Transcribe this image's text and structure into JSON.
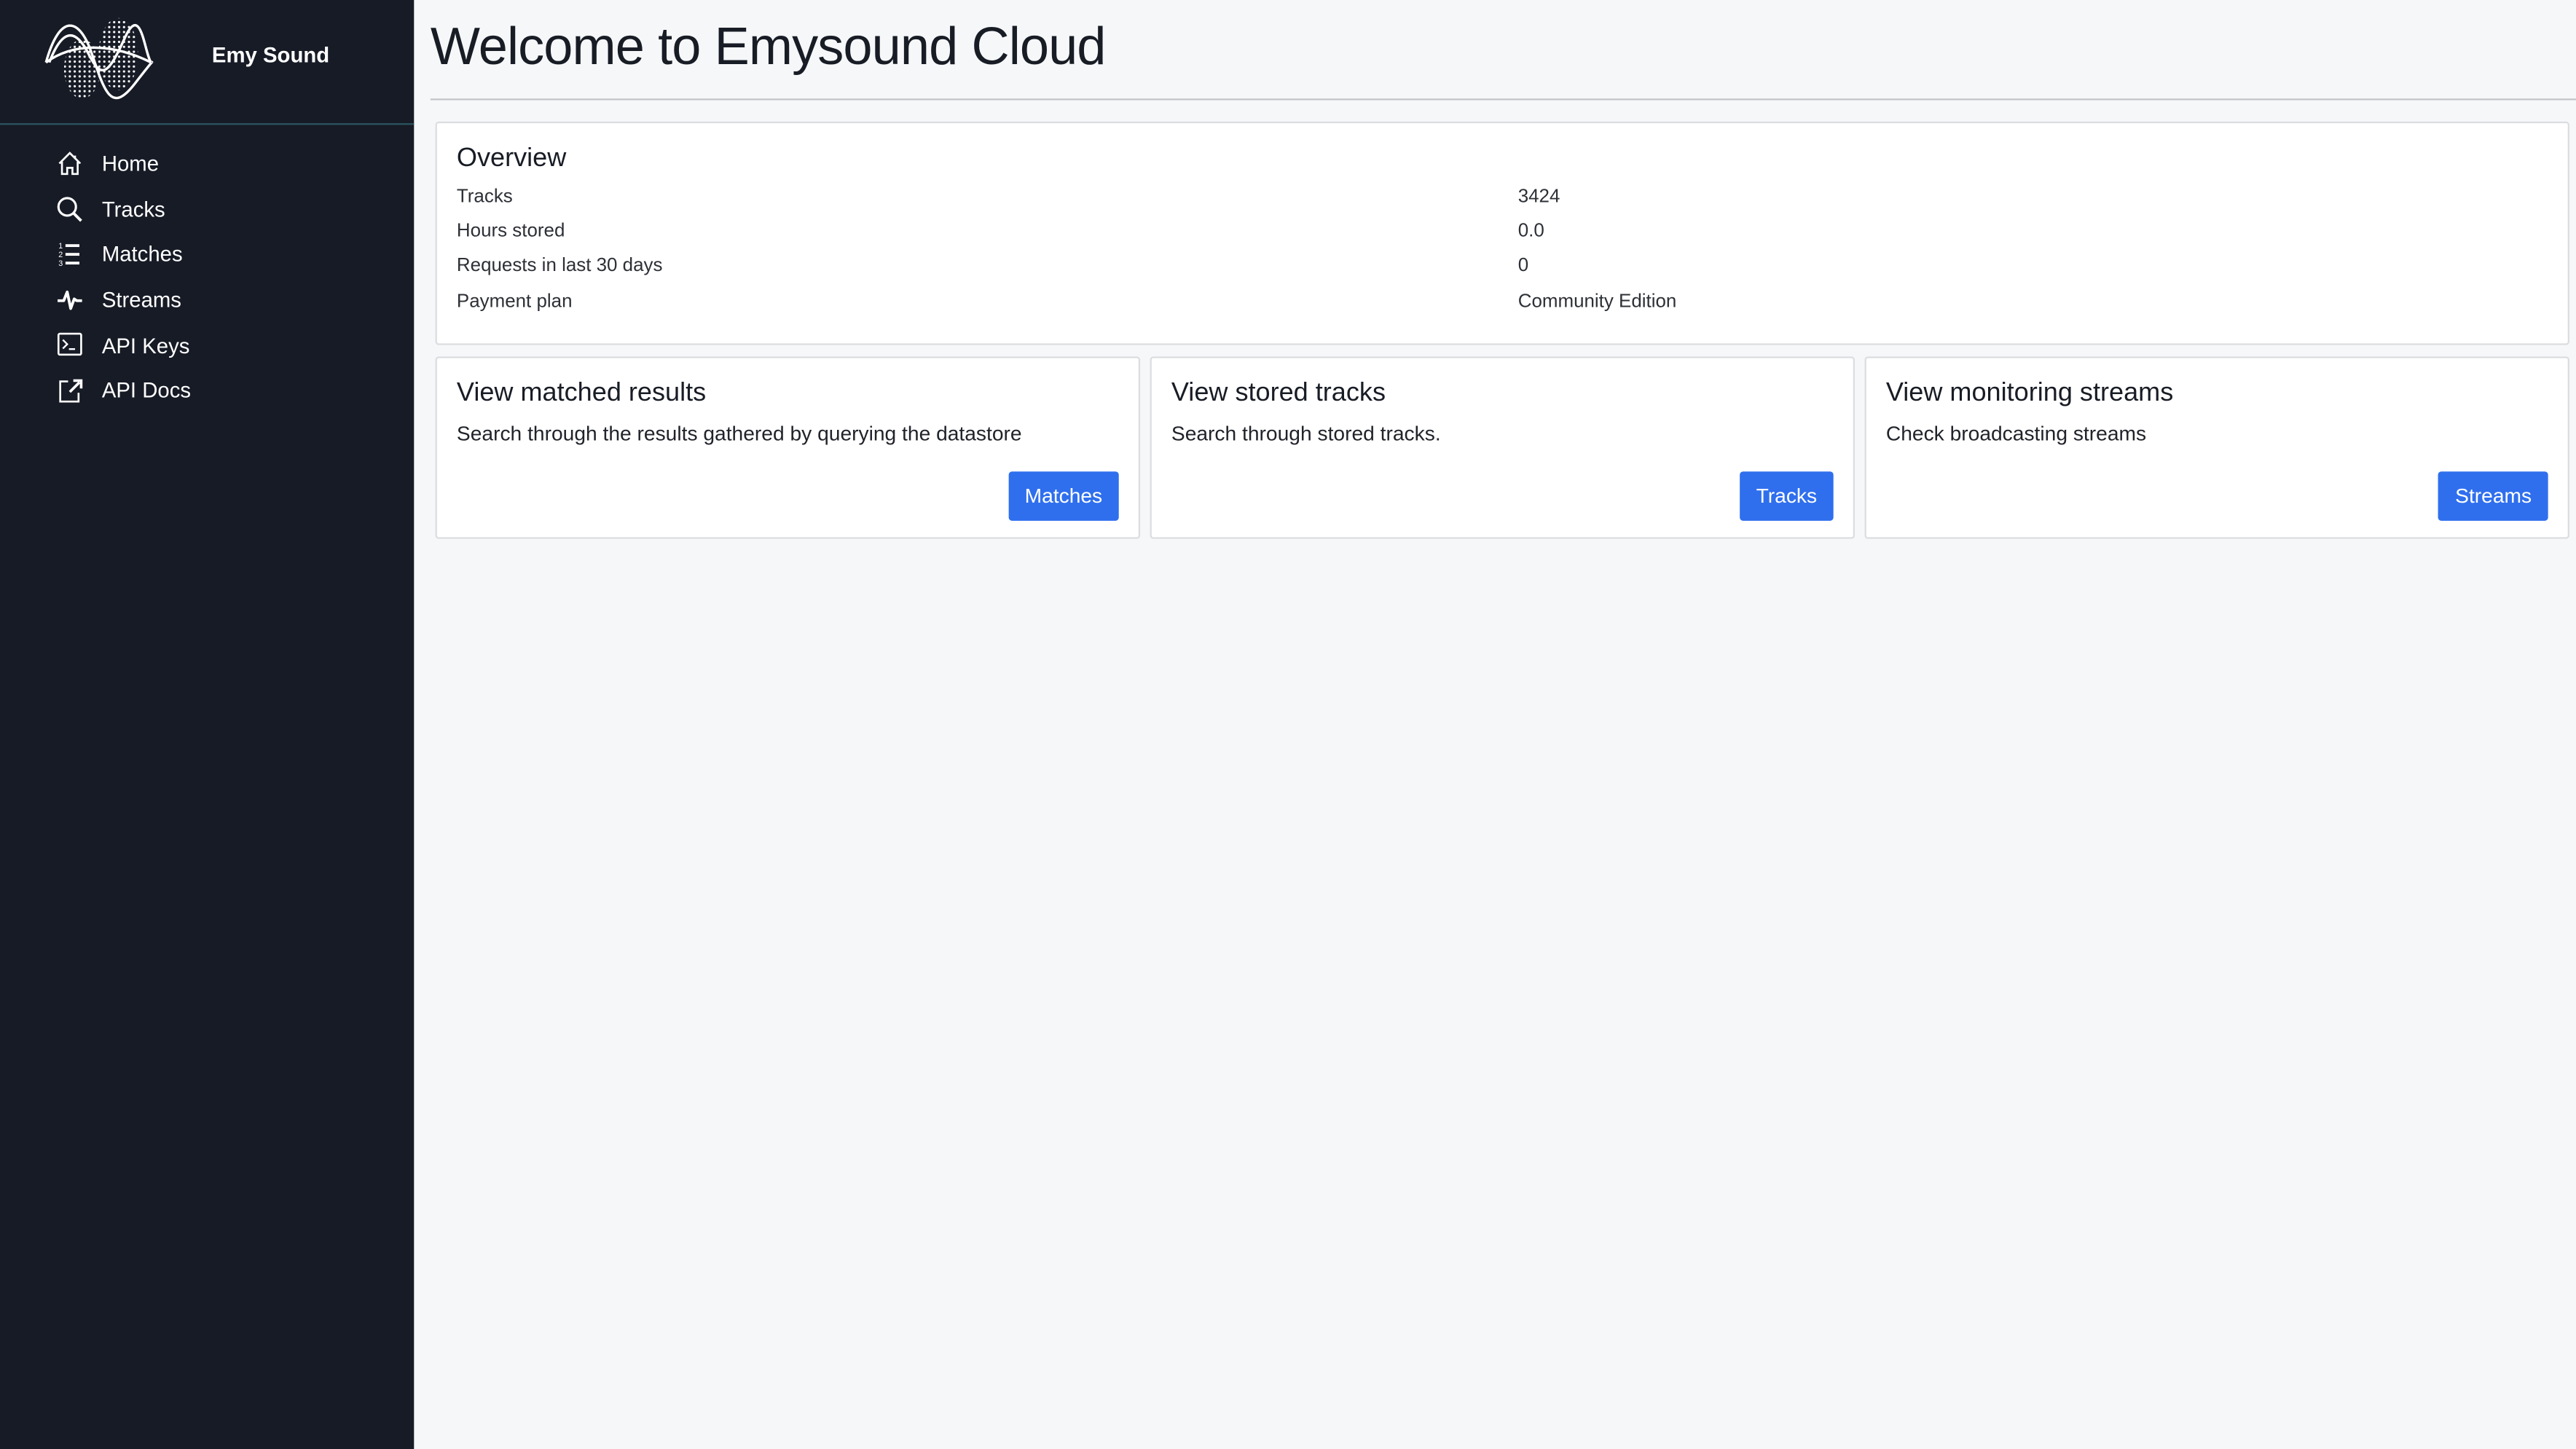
{
  "brand": {
    "name": "Emy Sound",
    "logo": "emy-sound-waveform-logo"
  },
  "sidebar": {
    "items": [
      {
        "label": "Home",
        "icon": "home-icon"
      },
      {
        "label": "Tracks",
        "icon": "search-icon"
      },
      {
        "label": "Matches",
        "icon": "numbered-list-icon"
      },
      {
        "label": "Streams",
        "icon": "pulse-icon"
      },
      {
        "label": "API Keys",
        "icon": "terminal-icon"
      },
      {
        "label": "API Docs",
        "icon": "external-link-icon"
      }
    ]
  },
  "page": {
    "title": "Welcome to Emysound Cloud"
  },
  "overview": {
    "title": "Overview",
    "rows": [
      {
        "label": "Tracks",
        "value": "3424"
      },
      {
        "label": "Hours stored",
        "value": "0.0"
      },
      {
        "label": "Requests in last 30 days",
        "value": "0"
      },
      {
        "label": "Payment plan",
        "value": "Community Edition"
      }
    ]
  },
  "cards": [
    {
      "title": "View matched results",
      "description": "Search through the results gathered by querying the datastore",
      "button": "Matches"
    },
    {
      "title": "View stored tracks",
      "description": "Search through stored tracks.",
      "button": "Tracks"
    },
    {
      "title": "View monitoring streams",
      "description": "Check broadcasting streams",
      "button": "Streams"
    }
  ],
  "colors": {
    "sidebar_bg": "#171b26",
    "accent": "#2f6fee",
    "page_bg": "#f6f7f9",
    "divider": "#2a5560"
  }
}
